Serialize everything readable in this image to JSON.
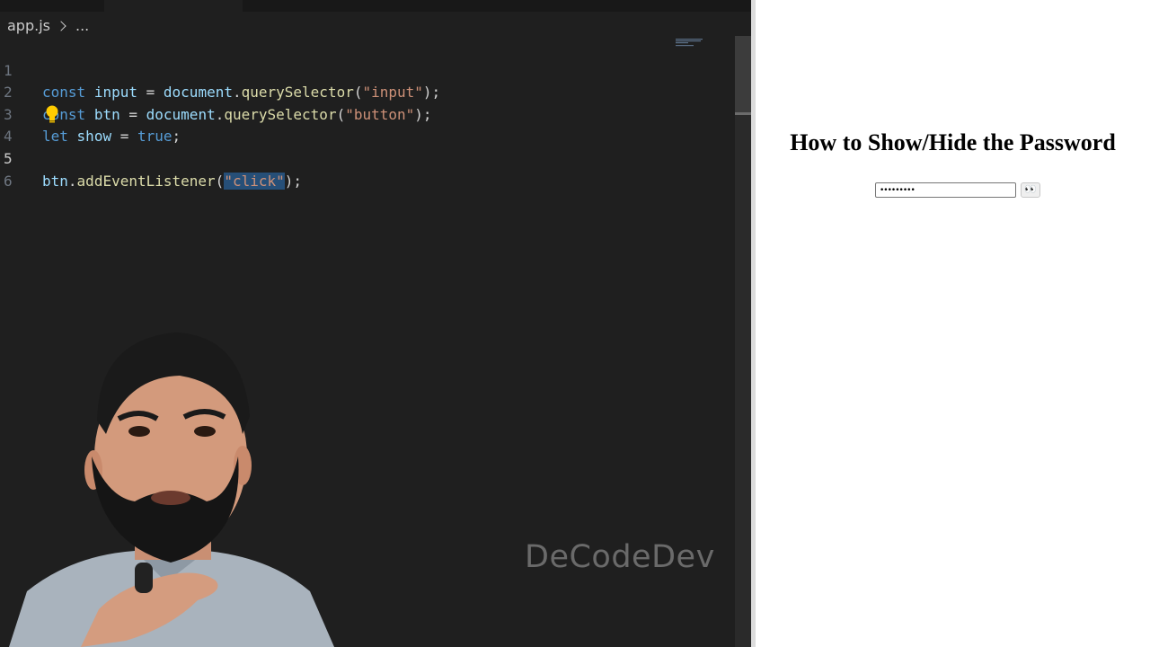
{
  "editor": {
    "breadcrumb": {
      "file": "app.js",
      "more": "..."
    },
    "lines": [
      {
        "num": "1",
        "tokens": [
          "const",
          "input",
          "=",
          "document",
          "querySelector",
          "\"input\""
        ]
      },
      {
        "num": "2",
        "tokens": [
          "const",
          "btn",
          "=",
          "document",
          "querySelector",
          "\"button\""
        ]
      },
      {
        "num": "3",
        "tokens": [
          "let",
          "show",
          "=",
          "true"
        ]
      },
      {
        "num": "4"
      },
      {
        "num": "5",
        "tokens": [
          "btn",
          "addEventListener",
          "\"click\""
        ]
      },
      {
        "num": "6"
      }
    ],
    "watermark": "DeCodeDev"
  },
  "browser": {
    "title": "How to Show/Hide the Password",
    "password_value": "•••••••••",
    "toggle_label": "👀"
  },
  "colors": {
    "editor_bg": "#1f1f1f",
    "keyword": "#569cd6",
    "variable": "#9cdcfe",
    "function": "#dcdcaa",
    "string": "#ce9178",
    "selection": "#264f78"
  },
  "icons": {
    "lightbulb": "lightbulb-icon",
    "eyes": "eyes-icon"
  }
}
